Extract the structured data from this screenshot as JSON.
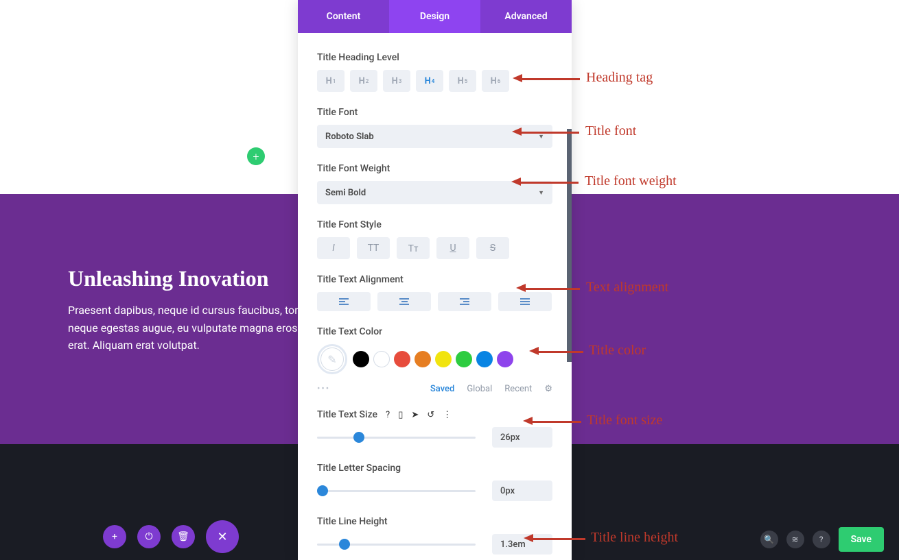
{
  "tabs": {
    "content": "Content",
    "design": "Design",
    "advanced": "Advanced"
  },
  "labels": {
    "heading_level": "Title Heading Level",
    "font": "Title Font",
    "font_weight": "Title Font Weight",
    "font_style": "Title Font Style",
    "alignment": "Title Text Alignment",
    "color": "Title Text Color",
    "size": "Title Text Size",
    "letter_spacing": "Title Letter Spacing",
    "line_height": "Title Line Height"
  },
  "headingLevels": [
    "H₁",
    "H₂",
    "H₃",
    "H₄",
    "H₅",
    "H₆"
  ],
  "headingActive": 3,
  "font": "Roboto Slab",
  "fontWeight": "Semi Bold",
  "fontStyles": [
    "I",
    "TT",
    "Tᴛ",
    "U",
    "S"
  ],
  "palette": {
    "tabs": {
      "saved": "Saved",
      "global": "Global",
      "recent": "Recent"
    },
    "colors": [
      "#000000",
      "#ffffff",
      "#e74c3c",
      "#e67e22",
      "#f1e40f",
      "#2ecc40",
      "#0984e3",
      "#8e44ec"
    ]
  },
  "sizes": {
    "text_size": "26px",
    "letter_spacing": "0px",
    "line_height": "1.3em"
  },
  "hero": {
    "title": "Unleashing Inovation",
    "body": "Praesent dapibus, neque id cursus faucibus, tortor neque egestas augue, eu vulputate magna eros eu erat. Aliquam erat volutpat."
  },
  "bottomBar": {
    "save": "Save"
  },
  "annotations": {
    "heading_tag": "Heading tag",
    "title_font": "Title font",
    "font_weight": "Title font weight",
    "alignment": "Text alignment",
    "color": "Title color",
    "font_size": "Title font size",
    "line_height": "Title line height"
  }
}
